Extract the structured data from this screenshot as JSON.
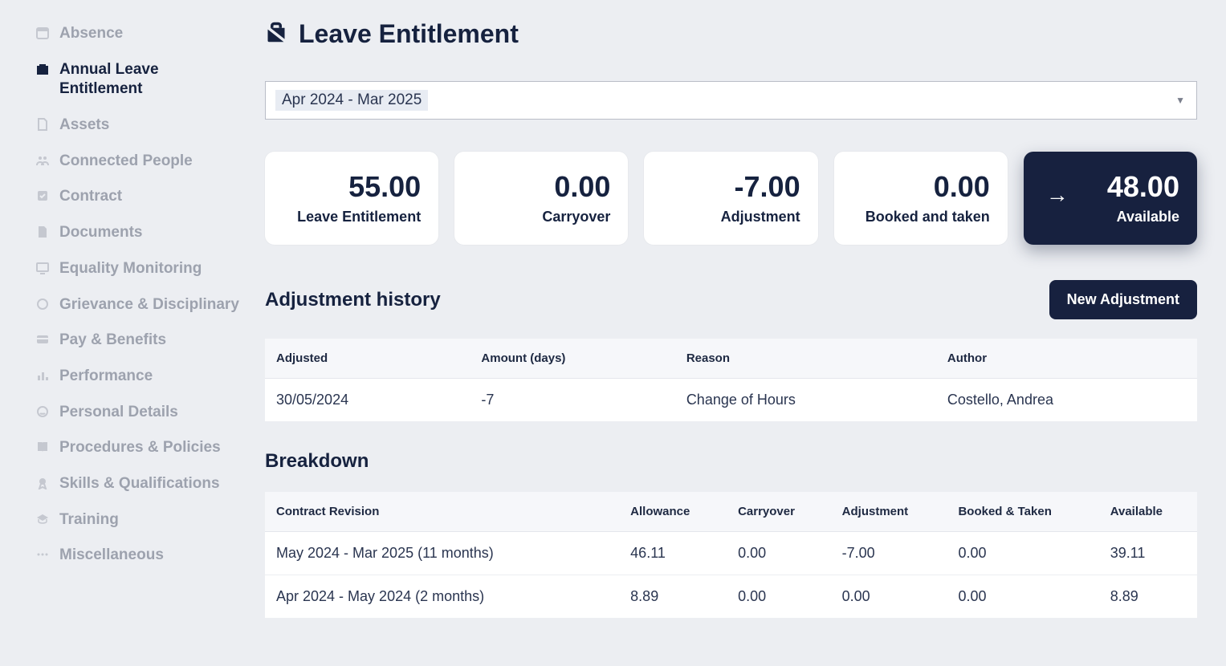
{
  "sidebar": {
    "items": [
      {
        "label": "Absence",
        "icon": "calendar"
      },
      {
        "label": "Annual Leave Entitlement",
        "icon": "briefcase",
        "active": true
      },
      {
        "label": "Assets",
        "icon": "file"
      },
      {
        "label": "Connected People",
        "icon": "people"
      },
      {
        "label": "Contract",
        "icon": "check-square"
      },
      {
        "label": "Documents",
        "icon": "doc"
      },
      {
        "label": "Equality Monitoring",
        "icon": "monitor"
      },
      {
        "label": "Grievance & Disciplinary",
        "icon": "face"
      },
      {
        "label": "Pay & Benefits",
        "icon": "card"
      },
      {
        "label": "Performance",
        "icon": "bar-chart"
      },
      {
        "label": "Personal Details",
        "icon": "smile"
      },
      {
        "label": "Procedures & Policies",
        "icon": "book"
      },
      {
        "label": "Skills & Qualifications",
        "icon": "medal"
      },
      {
        "label": "Training",
        "icon": "grad-cap"
      },
      {
        "label": "Miscellaneous",
        "icon": "dots"
      }
    ]
  },
  "page": {
    "title": "Leave Entitlement",
    "period_selected": "Apr 2024 - Mar 2025"
  },
  "cards": [
    {
      "value": "55.00",
      "label": "Leave Entitlement"
    },
    {
      "value": "0.00",
      "label": "Carryover"
    },
    {
      "value": "-7.00",
      "label": "Adjustment"
    },
    {
      "value": "0.00",
      "label": "Booked and taken"
    },
    {
      "value": "48.00",
      "label": "Available",
      "highlight": true
    }
  ],
  "adjustment": {
    "title": "Adjustment history",
    "new_button": "New Adjustment",
    "columns": [
      "Adjusted",
      "Amount (days)",
      "Reason",
      "Author"
    ],
    "rows": [
      {
        "adjusted": "30/05/2024",
        "amount": "-7",
        "reason": "Change of Hours",
        "author": "Costello, Andrea"
      }
    ]
  },
  "breakdown": {
    "title": "Breakdown",
    "columns": [
      "Contract Revision",
      "Allowance",
      "Carryover",
      "Adjustment",
      "Booked & Taken",
      "Available"
    ],
    "rows": [
      {
        "rev": "May 2024 - Mar 2025 (11 months)",
        "allowance": "46.11",
        "carryover": "0.00",
        "adjustment": "-7.00",
        "booked": "0.00",
        "available": "39.11"
      },
      {
        "rev": "Apr 2024 - May 2024 (2 months)",
        "allowance": "8.89",
        "carryover": "0.00",
        "adjustment": "0.00",
        "booked": "0.00",
        "available": "8.89"
      }
    ]
  }
}
